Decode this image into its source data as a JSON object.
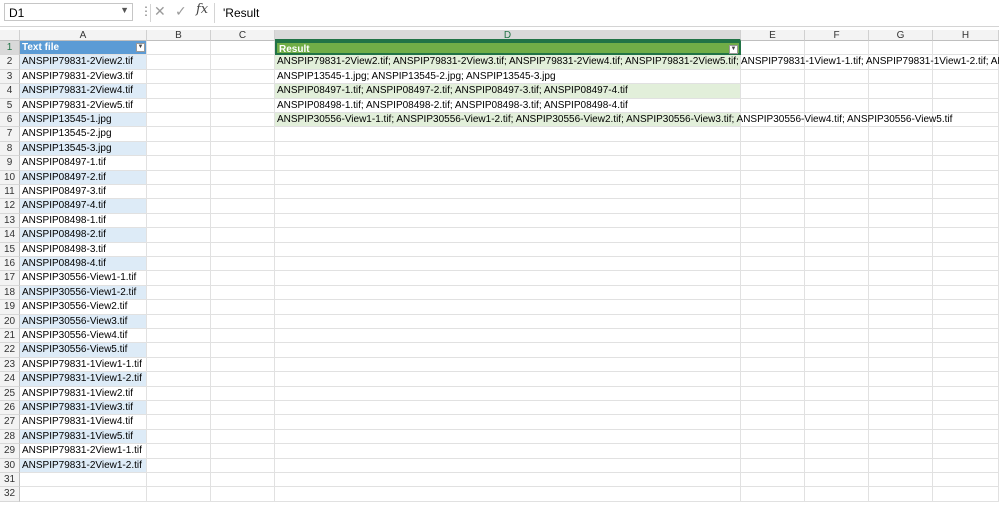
{
  "formula_bar": {
    "name_box": "D1",
    "formula": "'Result",
    "fx_label": "fx"
  },
  "columns": [
    "A",
    "B",
    "C",
    "D",
    "E",
    "F",
    "G",
    "H"
  ],
  "active_column": "D",
  "active_row": 1,
  "table_a": {
    "header": "Text file",
    "items": [
      "ANSPIP79831-2View2.tif",
      "ANSPIP79831-2View3.tif",
      "ANSPIP79831-2View4.tif",
      "ANSPIP79831-2View5.tif",
      "ANSPIP13545-1.jpg",
      "ANSPIP13545-2.jpg",
      "ANSPIP13545-3.jpg",
      "ANSPIP08497-1.tif",
      "ANSPIP08497-2.tif",
      "ANSPIP08497-3.tif",
      "ANSPIP08497-4.tif",
      "ANSPIP08498-1.tif",
      "ANSPIP08498-2.tif",
      "ANSPIP08498-3.tif",
      "ANSPIP08498-4.tif",
      "ANSPIP30556-View1-1.tif",
      "ANSPIP30556-View1-2.tif",
      "ANSPIP30556-View2.tif",
      "ANSPIP30556-View3.tif",
      "ANSPIP30556-View4.tif",
      "ANSPIP30556-View5.tif",
      "ANSPIP79831-1View1-1.tif",
      "ANSPIP79831-1View1-2.tif",
      "ANSPIP79831-1View2.tif",
      "ANSPIP79831-1View3.tif",
      "ANSPIP79831-1View4.tif",
      "ANSPIP79831-1View5.tif",
      "ANSPIP79831-2View1-1.tif",
      "ANSPIP79831-2View1-2.tif"
    ]
  },
  "table_d": {
    "header": "Result",
    "items": [
      "ANSPIP79831-2View2.tif; ANSPIP79831-2View3.tif; ANSPIP79831-2View4.tif; ANSPIP79831-2View5.tif; ANSPIP79831-1View1-1.tif; ANSPIP79831-1View1-2.tif; AN",
      "ANSPIP13545-1.jpg; ANSPIP13545-2.jpg; ANSPIP13545-3.jpg",
      "ANSPIP08497-1.tif; ANSPIP08497-2.tif; ANSPIP08497-3.tif; ANSPIP08497-4.tif",
      "ANSPIP08498-1.tif; ANSPIP08498-2.tif; ANSPIP08498-3.tif; ANSPIP08498-4.tif",
      "ANSPIP30556-View1-1.tif; ANSPIP30556-View1-2.tif; ANSPIP30556-View2.tif; ANSPIP30556-View3.tif; ANSPIP30556-View4.tif; ANSPIP30556-View5.tif"
    ]
  },
  "row_count": 32,
  "colors": {
    "a_header": "#5b9bd5",
    "a_band": "#ddebf7",
    "d_header": "#70ad47",
    "d_band": "#e2efda",
    "selection": "#217346"
  }
}
